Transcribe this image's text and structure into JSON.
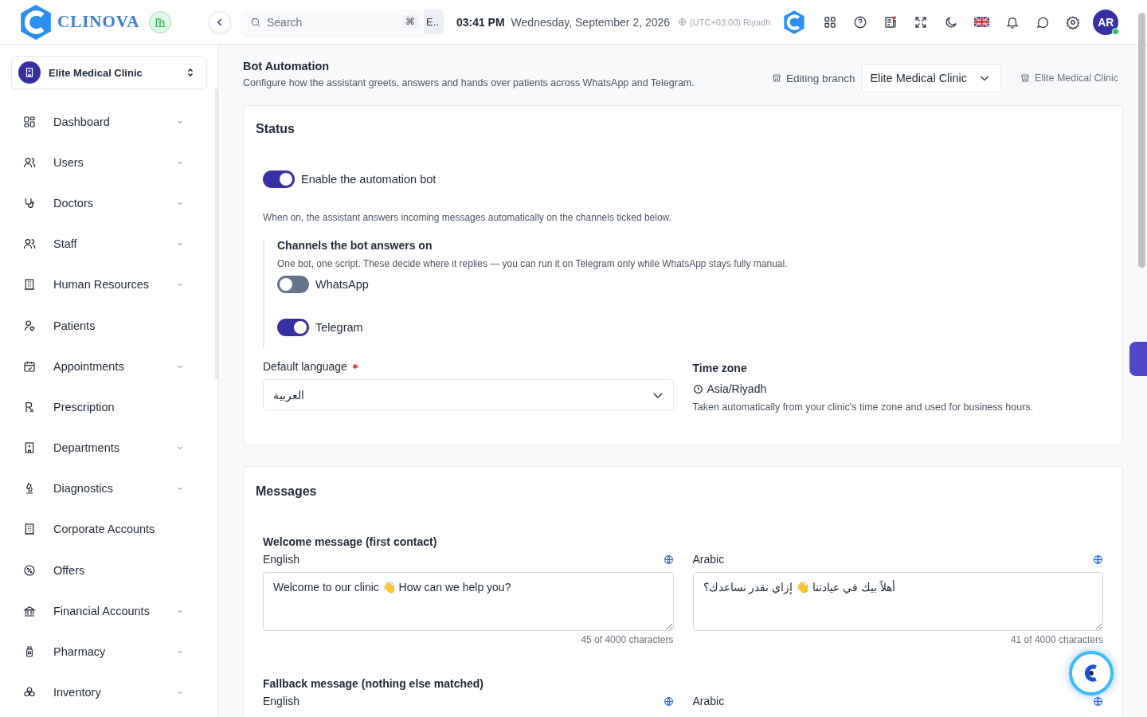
{
  "brand": {
    "name": "CLINOVA"
  },
  "header": {
    "search_placeholder": "Search",
    "shortcut": "⌘",
    "chip": "E..",
    "time": "03:41 PM",
    "date": "Wednesday, September 2, 2026",
    "timezone": "(UTC+03:00) Riyadh",
    "avatar": "AR",
    "online": true
  },
  "sidebar": {
    "clinic": "Elite Medical Clinic",
    "items": [
      {
        "label": "Dashboard",
        "kind": "group"
      },
      {
        "label": "Users",
        "kind": "group"
      },
      {
        "label": "Doctors",
        "kind": "group"
      },
      {
        "label": "Staff",
        "kind": "group"
      },
      {
        "label": "Human Resources",
        "kind": "group"
      },
      {
        "label": "Patients",
        "kind": "link"
      },
      {
        "label": "Appointments",
        "kind": "group"
      },
      {
        "label": "Prescription",
        "kind": "link"
      },
      {
        "label": "Departments",
        "kind": "group"
      },
      {
        "label": "Diagnostics",
        "kind": "group"
      },
      {
        "label": "Corporate Accounts",
        "kind": "link"
      },
      {
        "label": "Offers",
        "kind": "link"
      },
      {
        "label": "Financial Accounts",
        "kind": "group"
      },
      {
        "label": "Pharmacy",
        "kind": "group"
      },
      {
        "label": "Inventory",
        "kind": "group"
      }
    ]
  },
  "page": {
    "title": "Bot Automation",
    "subtitle": "Configure how the assistant greets, answers and hands over patients across WhatsApp and Telegram.",
    "branch_label": "Editing branch",
    "branch_value": "Elite Medical Clinic",
    "branch_current": "Elite Medical Clinic"
  },
  "status": {
    "title": "Status",
    "enabled": true,
    "enable_label": "Enable the automation bot",
    "hint": "When on, the assistant answers incoming messages automatically on the channels ticked below.",
    "channels_title": "Channels the bot answers on",
    "channels_hint": "One bot, one script. These decide where it replies — you can run it on Telegram only while WhatsApp stays fully manual.",
    "channels": [
      {
        "name": "WhatsApp",
        "on": false
      },
      {
        "name": "Telegram",
        "on": true
      }
    ],
    "language_label": "Default language",
    "language_required": true,
    "language_value": "العربية",
    "timezone_label": "Time zone",
    "timezone_value": "Asia/Riyadh",
    "timezone_hint": "Taken automatically from your clinic's time zone and used for business hours."
  },
  "messages": {
    "title": "Messages",
    "groups": [
      {
        "title": "Welcome message (first contact)",
        "fields": [
          {
            "label": "English",
            "value": "Welcome to our clinic 👋 How can we help you?",
            "count": "45 of 4000 characters"
          },
          {
            "label": "Arabic",
            "value": "أهلاً بيك في عيادتنا 👋 إزاي نقدر نساعدك؟",
            "count": "41 of 4000 characters"
          }
        ]
      },
      {
        "title": "Fallback message (nothing else matched)",
        "fields": [
          {
            "label": "English"
          },
          {
            "label": "Arabic"
          }
        ]
      }
    ]
  }
}
